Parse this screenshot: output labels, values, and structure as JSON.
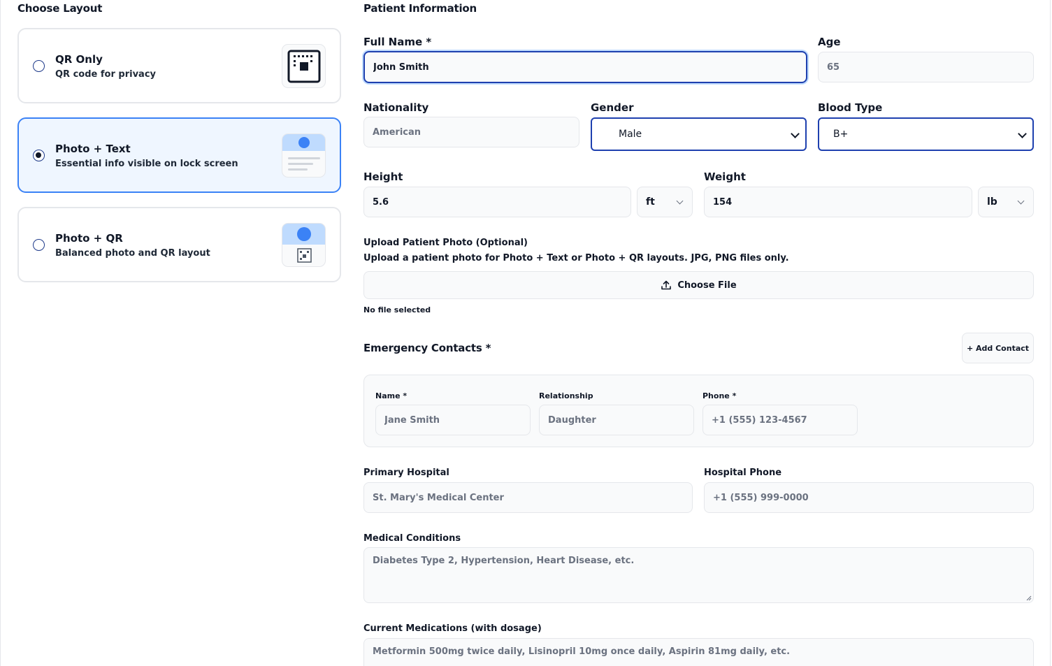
{
  "layout": {
    "title": "Choose Layout",
    "options": [
      {
        "title": "QR Only",
        "desc": "QR code for privacy",
        "selected": false
      },
      {
        "title": "Photo + Text",
        "desc": "Essential info visible on lock screen",
        "selected": true
      },
      {
        "title": "Photo + QR",
        "desc": "Balanced photo and QR layout",
        "selected": false
      }
    ]
  },
  "patient": {
    "title": "Patient Information",
    "full_name": {
      "label": "Full Name *",
      "value": "John Smith"
    },
    "age": {
      "label": "Age",
      "placeholder": "65"
    },
    "nationality": {
      "label": "Nationality",
      "placeholder": "American"
    },
    "gender": {
      "label": "Gender",
      "value": "Male"
    },
    "blood_type": {
      "label": "Blood Type",
      "value": "B+"
    },
    "height": {
      "label": "Height",
      "value": "5.6",
      "unit": "ft"
    },
    "weight": {
      "label": "Weight",
      "value": "154",
      "unit": "lb"
    }
  },
  "upload": {
    "title": "Upload Patient Photo (Optional)",
    "desc": "Upload a patient photo for Photo + Text or Photo + QR layouts. JPG, PNG files only.",
    "button": "Choose File",
    "status": "No file selected"
  },
  "contacts": {
    "title": "Emergency Contacts *",
    "add_button": "+ Add Contact",
    "name_label": "Name *",
    "name_placeholder": "Jane Smith",
    "relationship_label": "Relationship",
    "relationship_placeholder": "Daughter",
    "phone_label": "Phone *",
    "phone_placeholder": "+1 (555) 123-4567"
  },
  "hospital": {
    "label": "Primary Hospital",
    "placeholder": "St. Mary's Medical Center",
    "phone_label": "Hospital Phone",
    "phone_placeholder": "+1 (555) 999-0000"
  },
  "conditions": {
    "label": "Medical Conditions",
    "placeholder": "Diabetes Type 2, Hypertension, Heart Disease, etc."
  },
  "medications": {
    "label": "Current Medications (with dosage)",
    "placeholder": "Metformin 500mg twice daily, Lisinopril 10mg once daily, Aspirin 81mg daily, etc."
  },
  "colors": {
    "accent": "#3b82f6",
    "focus": "#1e40af",
    "selected_bg": "#eff6ff",
    "field_bg": "#f9fafb",
    "border": "#e5e7eb"
  }
}
